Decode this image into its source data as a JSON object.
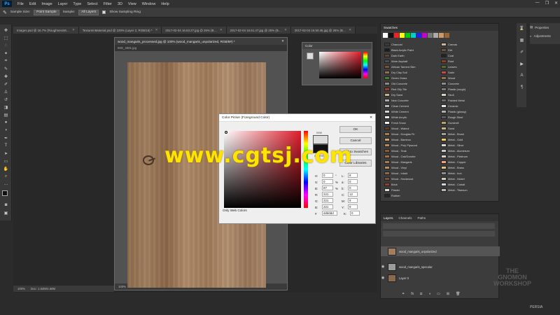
{
  "app": {
    "logo": "Ps"
  },
  "menu": [
    "File",
    "Edit",
    "Image",
    "Layer",
    "Type",
    "Select",
    "Filter",
    "3D",
    "View",
    "Window",
    "Help"
  ],
  "window_controls": [
    "—",
    "❐",
    "✕"
  ],
  "options": {
    "sample_size_label": "Sample Size:",
    "sample_size_value": "Point Sample",
    "sample_label": "Sample:",
    "sample_value": "All Layers",
    "show_ring_label": "Show Sampling Ring"
  },
  "doc_tabs": [
    "Images.psd @ 16.7% (RoughnessM…",
    "TextureInMaterial.psd @ 100% (Layer 2, RGB/16) *",
    "2017-02-04 16.53.27.jpg @ 25% (B…",
    "2017-02-04 16.51.47.jpg @ 25% (B…",
    "2017-02-04 16.50.45.jpg @ 25% (B…"
  ],
  "float_window": {
    "title": "wood_mangaris_processed.jpg @ 100% (wood_mangaris_unpolarized, RGB/8#) *",
    "second_tab": "IMG_2581.jpg",
    "zoom": "100%",
    "doc_info": "Doc: 1.53M/4.68M",
    "bottom_zoom": "100%",
    "bottom_doc": "Doc: 1.53M/4.68M"
  },
  "color_panel": {
    "title": "Color"
  },
  "color_picker": {
    "title": "Color Picker (Foreground Color)",
    "ok": "OK",
    "cancel": "Cancel",
    "add_to_swatches": "Add to Swatches",
    "color_libraries": "Color Libraries",
    "label_new": "new",
    "label_current": "current",
    "only_web": "Only Web Colors",
    "fields": [
      {
        "l": "H:",
        "v": "0",
        "u": "°",
        "l2": "L:",
        "v2": "8"
      },
      {
        "l": "S:",
        "v": "0",
        "u": "%",
        "l2": "a:",
        "v2": "0"
      },
      {
        "l": "B:",
        "v": "87",
        "u": "%",
        "l2": "b:",
        "v2": "0"
      },
      {
        "l": "R:",
        "v": "221",
        "u": "",
        "l2": "C:",
        "v2": "12"
      },
      {
        "l": "G:",
        "v": "221",
        "u": "",
        "l2": "M:",
        "v2": "9"
      },
      {
        "l": "B:",
        "v": "221",
        "u": "",
        "l2": "Y:",
        "v2": "9"
      },
      {
        "l": "#",
        "v": "dddddd",
        "u": "",
        "l2": "K:",
        "v2": "0"
      }
    ]
  },
  "swatches": {
    "title": "Swatches",
    "left": [
      {
        "name": "Charcoal",
        "c": "#3b3b3b"
      },
      {
        "name": "Black Acrylic Paint",
        "c": "#1c1c1c"
      },
      {
        "name": "Dark Earth",
        "c": "#5a4636"
      },
      {
        "name": "Worn Asphalt",
        "c": "#4d4d4d"
      },
      {
        "name": "African Tanned Skin",
        "c": "#7a4e3a"
      },
      {
        "name": "Dry Clay Soil",
        "c": "#8f6f56"
      },
      {
        "name": "Green Grass",
        "c": "#4d7a2e"
      },
      {
        "name": "Old Concrete",
        "c": "#8a8a86"
      },
      {
        "name": "Red Oily Tile",
        "c": "#9b3d2f"
      },
      {
        "name": "Dry Sand",
        "c": "#c7b08a"
      },
      {
        "name": "New Concrete",
        "c": "#a8a8a4"
      },
      {
        "name": "Clean Cement",
        "c": "#b9b9b5"
      },
      {
        "name": "White Cement",
        "c": "#d6d6d2"
      },
      {
        "name": "White Acrylic",
        "c": "#ebebeb"
      },
      {
        "name": "Fresh Snow",
        "c": "#f7f7f7"
      },
      {
        "name": "Wood - Walnut",
        "c": "#5c3d26"
      },
      {
        "name": "Wood - Douglas Fir",
        "c": "#a97b4f"
      },
      {
        "name": "Wood - Bamboo",
        "c": "#c9a46b"
      },
      {
        "name": "Wood - Poly Plywood",
        "c": "#b88a5c"
      },
      {
        "name": "Wood - Teak",
        "c": "#8b5a33"
      },
      {
        "name": "Wood - Oak/Dorotte",
        "c": "#9b7145"
      },
      {
        "name": "Wood - Mangaris",
        "c": "#a87a55"
      },
      {
        "name": "Wood - Vinyl",
        "c": "#b69068"
      },
      {
        "name": "Wood - Inlaid",
        "c": "#8a6a4a"
      },
      {
        "name": "Wood - Hardwood",
        "c": "#7a5438"
      },
      {
        "name": "Brick",
        "c": "#8f3f2c"
      },
      {
        "name": "Plaster",
        "c": "#e0dcd3"
      },
      {
        "name": "Rubber",
        "c": "#262626"
      }
    ],
    "right": [
      {
        "name": "Canvas",
        "c": "#c9b79a"
      },
      {
        "name": "Dirt",
        "c": "#6b5340"
      },
      {
        "name": "Coal",
        "c": "#222222"
      },
      {
        "name": "Rust",
        "c": "#8a3f1f"
      },
      {
        "name": "Leaves",
        "c": "#556b2f"
      },
      {
        "name": "Satin",
        "c": "#c24a4a"
      },
      {
        "name": "Wood",
        "c": "#9c7048"
      },
      {
        "name": "Concrete",
        "c": "#8c8c88"
      },
      {
        "name": "Plastic (rough)",
        "c": "#7a7a7a"
      },
      {
        "name": "Skull",
        "c": "#d8d2c0"
      },
      {
        "name": "Painted Metal",
        "c": "#6a6a70"
      },
      {
        "name": "Ceramic",
        "c": "#e5e5e5"
      },
      {
        "name": "Plastic (glossy)",
        "c": "#b0b0b0"
      },
      {
        "name": "Rough Steel",
        "c": "#5a5a5a"
      },
      {
        "name": "Gunshell",
        "c": "#bca26a"
      },
      {
        "name": "Sand",
        "c": "#c8b28c"
      },
      {
        "name": "Metal - Brush",
        "c": "#a0a0a0"
      },
      {
        "name": "Metal - Gold",
        "c": "#f4c95d"
      },
      {
        "name": "Metal - Silver",
        "c": "#d8d8d8"
      },
      {
        "name": "Metal - Aluminium",
        "c": "#c9c9c9"
      },
      {
        "name": "Metal - Platinum",
        "c": "#d5d0c8"
      },
      {
        "name": "Metal - Copper",
        "c": "#f5a27c"
      },
      {
        "name": "Metal - Brass",
        "c": "#e5c17a"
      },
      {
        "name": "Metal - Iron",
        "c": "#8e8e8e"
      },
      {
        "name": "Metal - Nickel",
        "c": "#d2cbbd"
      },
      {
        "name": "Metal - Cobalt",
        "c": "#d4d4dc"
      },
      {
        "name": "Metal - Titanium",
        "c": "#c1b8ab"
      }
    ]
  },
  "layers": {
    "tabs": [
      "Layers",
      "Channels",
      "Paths"
    ],
    "rows": [
      {
        "name": "wood_mangaris_unpolarized",
        "c": "#a17f5f"
      },
      {
        "name": "wood_mangaris_specular",
        "c": "#9c9c9c"
      },
      {
        "name": "Layer 0",
        "c": "#8a6a4a"
      }
    ]
  },
  "right_panel": {
    "properties": "Properties",
    "adjustments": "Adjustments"
  },
  "watermark": "www.cgtsj.com",
  "brand": {
    "line1": "THE",
    "line2": "GNOMON",
    "line3": "WORKSHOP"
  },
  "corner_logo": "PERSIA",
  "status": {
    "zoom": "100%",
    "doc": "Doc: 1.53M/4.68M"
  }
}
